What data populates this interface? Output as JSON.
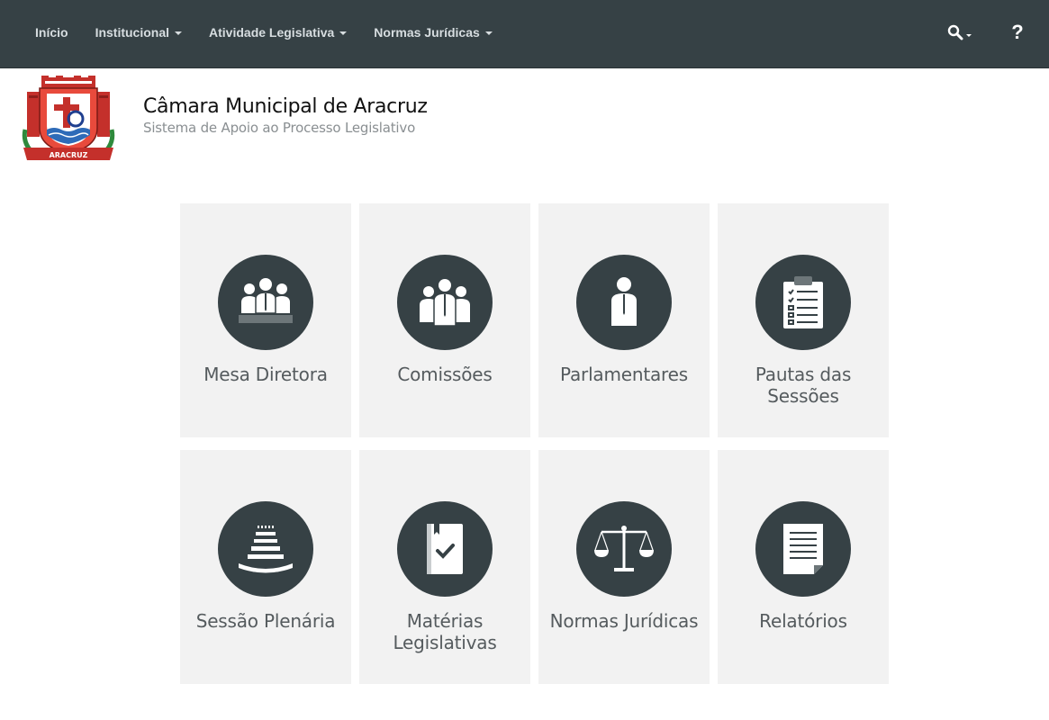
{
  "navbar": {
    "items": [
      {
        "label": "Início",
        "has_caret": false
      },
      {
        "label": "Institucional",
        "has_caret": true
      },
      {
        "label": "Atividade Legislativa",
        "has_caret": true
      },
      {
        "label": "Normas Jurídicas",
        "has_caret": true
      }
    ],
    "search_icon": "search-icon",
    "help_label": "?"
  },
  "header": {
    "logo_text": "ARACRUZ",
    "title": "Câmara Municipal de Aracruz",
    "subtitle": "Sistema de Apoio ao Processo Legislativo"
  },
  "tiles": [
    {
      "label": "Mesa Diretora",
      "icon": "board-table-icon"
    },
    {
      "label": "Comissões",
      "icon": "group-people-icon"
    },
    {
      "label": "Parlamentares",
      "icon": "person-icon"
    },
    {
      "label": "Pautas das Sessões",
      "icon": "clipboard-checklist-icon"
    },
    {
      "label": "Sessão Plenária",
      "icon": "plenary-icon"
    },
    {
      "label": "Matérias Legislativas",
      "icon": "book-check-icon"
    },
    {
      "label": "Normas Jurídicas",
      "icon": "scales-icon"
    },
    {
      "label": "Relatórios",
      "icon": "document-icon"
    }
  ],
  "colors": {
    "navbar_bg": "#364145",
    "tile_bg": "#f2f2f2",
    "icon_circle": "#364145",
    "label_text": "#555b5e"
  }
}
